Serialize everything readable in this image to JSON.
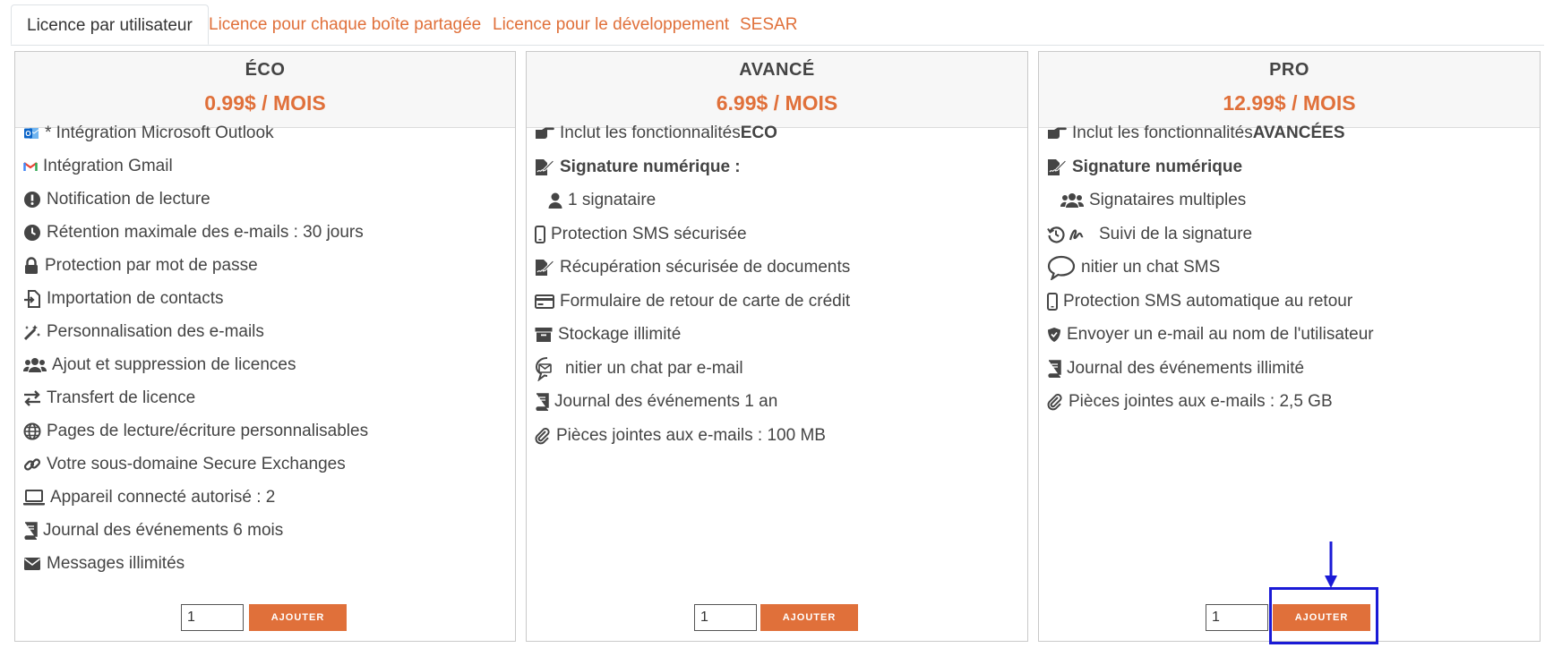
{
  "tabs": [
    {
      "label": "Licence par utilisateur",
      "active": true
    },
    {
      "label": "Licence pour chaque boîte partagée",
      "active": false
    },
    {
      "label": "Licence pour le développement",
      "active": false
    },
    {
      "label": "SESAR",
      "active": false
    }
  ],
  "plans": [
    {
      "name": "ÉCO",
      "price": "0.99$ / MOIS",
      "quantity": "1",
      "button": "AJOUTER",
      "features": [
        {
          "icon": "outlook-icon",
          "text": "* Intégration Microsoft Outlook"
        },
        {
          "icon": "gmail-icon",
          "text": "Intégration Gmail"
        },
        {
          "icon": "exclamation-circle-icon",
          "text": "Notification de lecture"
        },
        {
          "icon": "clock-icon",
          "text": "Rétention maximale des e-mails : 30 jours"
        },
        {
          "icon": "lock-icon",
          "text": "Protection par mot de passe"
        },
        {
          "icon": "file-import-icon",
          "text": "Importation de contacts"
        },
        {
          "icon": "magic-wand-icon",
          "text": "Personnalisation des e-mails"
        },
        {
          "icon": "users-icon",
          "text": "Ajout et suppression de licences"
        },
        {
          "icon": "exchange-arrows-icon",
          "text": "Transfert de licence"
        },
        {
          "icon": "globe-icon",
          "text": "Pages de lecture/écriture personnalisables"
        },
        {
          "icon": "link-icon",
          "text": "Votre sous-domaine Secure Exchanges"
        },
        {
          "icon": "laptop-icon",
          "text": "Appareil connecté autorisé : 2"
        },
        {
          "icon": "book-icon",
          "text": "Journal des événements 6 mois"
        },
        {
          "icon": "envelope-icon",
          "text": "Messages illimités"
        }
      ]
    },
    {
      "name": "AVANCÉ",
      "price": "6.99$ / MOIS",
      "quantity": "1",
      "button": "AJOUTER",
      "features": [
        {
          "icon": "hand-point-right-icon",
          "text": "Inclut les fonctionnalités ",
          "bold": "ECO"
        },
        {
          "icon": "file-signature-icon",
          "text": "",
          "bold": "Signature numérique :"
        },
        {
          "icon": "user-icon",
          "text": "1 signataire",
          "indent": true
        },
        {
          "icon": "mobile-icon",
          "text": "Protection SMS sécurisée"
        },
        {
          "icon": "file-signature-icon",
          "text": "Récupération sécurisée de documents"
        },
        {
          "icon": "credit-card-icon",
          "text": "Formulaire de retour de carte de crédit"
        },
        {
          "icon": "archive-box-icon",
          "text": "Stockage illimité"
        },
        {
          "icon": "comment-envelope-icon",
          "text": "nitier un chat par e-mail"
        },
        {
          "icon": "book-icon",
          "text": "Journal des événements 1 an"
        },
        {
          "icon": "paperclip-icon",
          "text": "Pièces jointes aux e-mails : 100 MB"
        }
      ]
    },
    {
      "name": "PRO",
      "price": "12.99$ / MOIS",
      "quantity": "1",
      "button": "AJOUTER",
      "features": [
        {
          "icon": "hand-point-right-icon",
          "text": "Inclut les fonctionnalités ",
          "bold": "AVANCÉES"
        },
        {
          "icon": "file-signature-icon",
          "text": "",
          "bold": "Signature numérique"
        },
        {
          "icon": "users-icon",
          "text": "Signataires multiples",
          "indent": true
        },
        {
          "icon": "history-signature-icon",
          "text": "Suivi de la signature"
        },
        {
          "icon": "comment-icon",
          "text": "nitier un chat SMS"
        },
        {
          "icon": "mobile-icon",
          "text": "Protection SMS automatique au retour"
        },
        {
          "icon": "shield-icon",
          "text": "Envoyer un e-mail au nom de l'utilisateur"
        },
        {
          "icon": "book-icon",
          "text": "Journal des événements illimité"
        },
        {
          "icon": "paperclip-icon",
          "text": "Pièces jointes aux e-mails : 2,5 GB"
        }
      ]
    }
  ],
  "colors": {
    "accent": "#e0703a",
    "highlight": "#1a1ad6"
  }
}
